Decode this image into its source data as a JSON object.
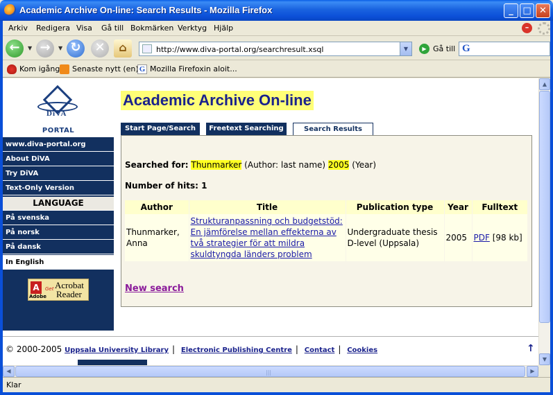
{
  "window": {
    "title": "Academic Archive On-line: Search Results - Mozilla Firefox",
    "buttons": {
      "minimize": "_",
      "maximize": "□",
      "close": "✕"
    }
  },
  "menu": [
    "Arkiv",
    "Redigera",
    "Visa",
    "Gå till",
    "Bokmärken",
    "Verktyg",
    "Hjälp"
  ],
  "toolbar": {
    "url": "http://www.diva-portal.org/searchresult.xsql",
    "go_label": "Gå till",
    "search_placeholder": ""
  },
  "bookmarks": [
    "Kom igång",
    "Senaste nytt (en)",
    "Mozilla Firefoxin aloit..."
  ],
  "sidebar": {
    "logo_text": "DiVA",
    "portal_label": "PORTAL",
    "items": [
      "www.diva-portal.org",
      "About DiVA",
      "Try DiVA",
      "Text-Only Version"
    ],
    "language_heading": "LANGUAGE",
    "languages": [
      "På svenska",
      "På norsk",
      "På dansk"
    ],
    "active_language": "In English",
    "acrobat": {
      "get": "Get",
      "line1": "Acrobat",
      "line2": "Reader",
      "brand": "Adobe"
    }
  },
  "main": {
    "title": "Academic Archive On-line",
    "tabs": [
      {
        "label": "Start Page/Search",
        "active": false
      },
      {
        "label": "Freetext Searching",
        "active": false
      },
      {
        "label": "Search Results",
        "active": true
      }
    ],
    "searched_for_label": "Searched for:",
    "query_author": "Thunmarker",
    "query_author_type": "(Author: last name)",
    "query_year": "2005",
    "query_year_type": "(Year)",
    "hits_label": "Number of hits:",
    "hits_count": "1",
    "table": {
      "headers": [
        "Author",
        "Title",
        "Publication type",
        "Year",
        "Fulltext"
      ],
      "rows": [
        {
          "author": "Thunmarker, Anna",
          "title": "Strukturanpassning och budgetstöd: En jämförelse mellan effekterna av två strategier för att mildra skuldtyngda länders problem",
          "type": "Undergraduate thesis D-level (Uppsala)",
          "year": "2005",
          "fulltext_link": "PDF",
          "fulltext_size": "[98 kb]"
        }
      ]
    },
    "new_search": "New search"
  },
  "footer": {
    "copyright": "© 2000-2005",
    "links": [
      "Uppsala University Library",
      "Electronic Publishing Centre",
      "Contact",
      "Cookies"
    ]
  },
  "status": "Klar",
  "colors": {
    "nav_bg": "#12305f",
    "highlight": "#ffff22",
    "title_bg": "#ffff77"
  }
}
